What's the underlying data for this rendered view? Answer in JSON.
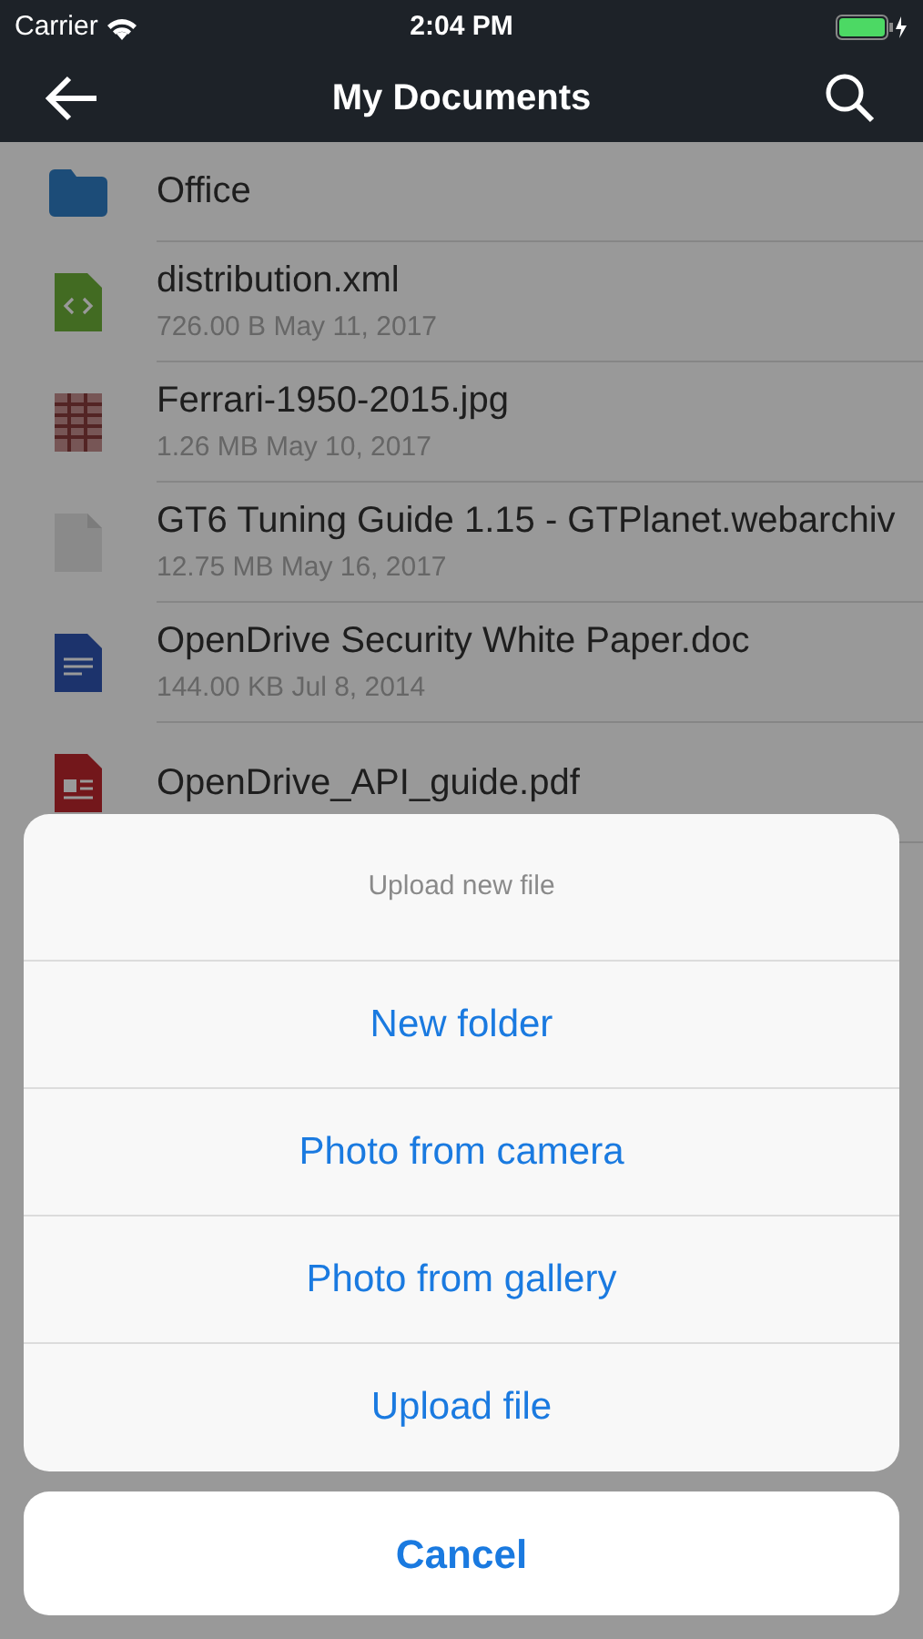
{
  "status_bar": {
    "carrier": "Carrier",
    "time": "2:04 PM"
  },
  "nav": {
    "title": "My Documents"
  },
  "files": [
    {
      "kind": "folder",
      "name": "Office"
    },
    {
      "kind": "xml",
      "name": "distribution.xml",
      "meta": "726.00 B May 11, 2017"
    },
    {
      "kind": "image",
      "name": "Ferrari-1950-2015.jpg",
      "meta": "1.26 MB May 10, 2017"
    },
    {
      "kind": "generic",
      "name": "GT6 Tuning Guide 1.15 - GTPlanet.webarchiv",
      "meta": "12.75 MB May 16, 2017"
    },
    {
      "kind": "doc",
      "name": "OpenDrive Security White Paper.doc",
      "meta": "144.00 KB Jul 8, 2014"
    },
    {
      "kind": "pdf",
      "name": "OpenDrive_API_guide.pdf"
    }
  ],
  "action_sheet": {
    "title": "Upload new file",
    "options": [
      "New folder",
      "Photo from camera",
      "Photo from gallery",
      "Upload file"
    ],
    "cancel": "Cancel"
  }
}
